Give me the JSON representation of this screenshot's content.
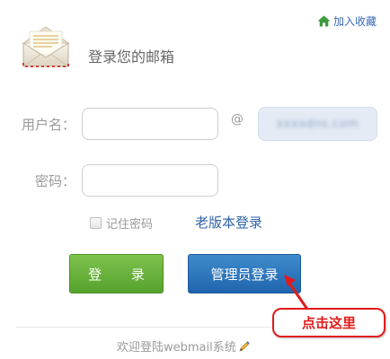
{
  "header": {
    "favorite_label": "加入收藏",
    "mailbox_title": "登录您的邮箱"
  },
  "form": {
    "username_label": "用户名：",
    "username_value": "",
    "at_sign": "@",
    "domain_value": "xxxxdns.com",
    "password_label": "密码：",
    "password_value": "",
    "remember_label": "记住密码",
    "remember_checked": false,
    "old_version_link": "老版本登录"
  },
  "buttons": {
    "login_label": "登 录",
    "admin_login_label": "管理员登录"
  },
  "annotation": {
    "callout_text": "点击这里"
  },
  "footer": {
    "welcome_text": "欢迎登陆webmail系统"
  },
  "colors": {
    "login_green": "#5aa832",
    "admin_blue": "#2670b8",
    "link_blue": "#2f63a8",
    "callout_red": "#e01b1b"
  },
  "icons": [
    "home-icon",
    "envelope-icon",
    "pen-icon",
    "arrow-icon"
  ]
}
